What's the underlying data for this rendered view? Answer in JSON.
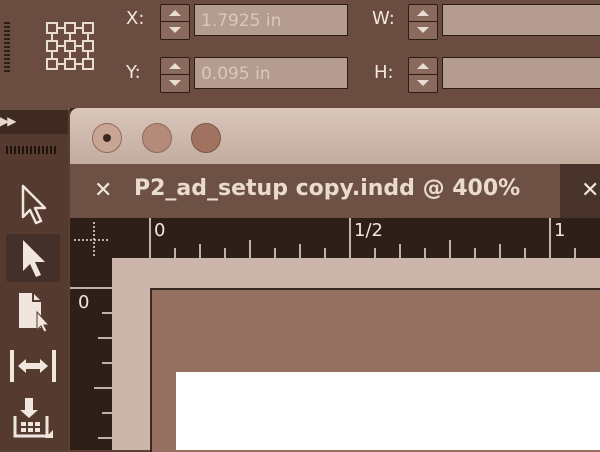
{
  "control_bar": {
    "x_label": "X:",
    "x_value": "1.7925 in",
    "y_label": "Y:",
    "y_value": "0.095 in",
    "w_label": "W:",
    "w_value": "",
    "h_label": "H:",
    "h_value": ""
  },
  "tools": [
    "selection-tool",
    "direct-selection-tool",
    "page-tool",
    "gap-tool",
    "content-collector-tool"
  ],
  "document": {
    "tab_title": "P2_ad_setup copy.indd @ 400%",
    "close_glyph": "✕"
  },
  "rulers": {
    "h_ticks": [
      "0",
      "1/2",
      "1"
    ],
    "v_ticks": [
      "0"
    ]
  },
  "colors": {
    "panel": "#6a4c40",
    "field": "#b59c90",
    "pasteboard": "#ccb6ab",
    "page": "#93705f"
  }
}
